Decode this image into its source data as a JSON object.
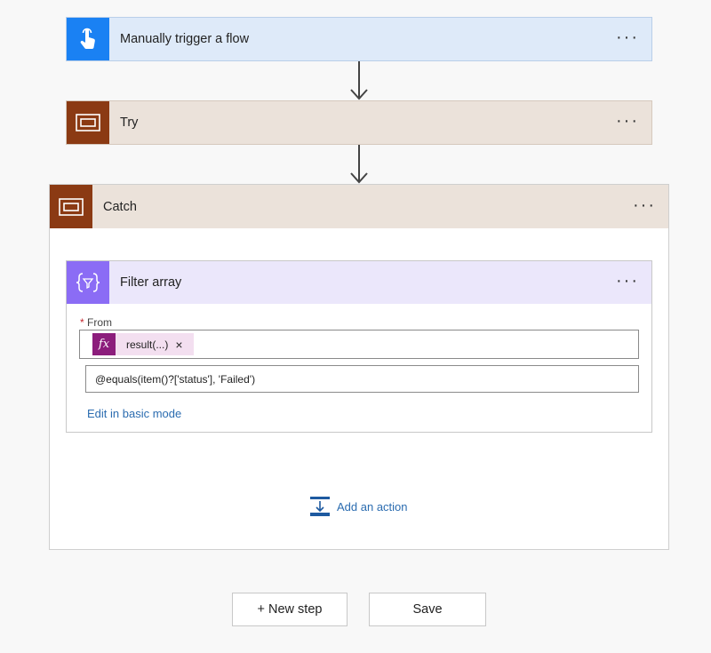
{
  "trigger": {
    "title": "Manually trigger a flow",
    "icon": "touch-hand-icon",
    "accent": "#1a81f3",
    "bg": "#deeaf9"
  },
  "try": {
    "title": "Try",
    "icon": "scope-icon",
    "accent": "#8b3a13",
    "bg": "#ebe2da"
  },
  "catch": {
    "title": "Catch",
    "icon": "scope-icon",
    "accent": "#8b3a13",
    "bg": "#ebe2da",
    "filter": {
      "title": "Filter array",
      "icon": "filter-array-icon",
      "accent": "#8b6cf5",
      "bg": "#ebe7fb",
      "from_required_marker": "*",
      "from_label": "From",
      "token_label": "result(...)",
      "token_remove": "×",
      "expression": "@equals(item()?['status'], 'Failed')",
      "edit_link": "Edit in basic mode"
    },
    "add_action": "Add an action"
  },
  "more_label": "···",
  "buttons": {
    "new_step": "+ New step",
    "save": "Save"
  },
  "colors": {
    "link": "#2b6cb0",
    "expression_token": "#8c1d7c"
  }
}
